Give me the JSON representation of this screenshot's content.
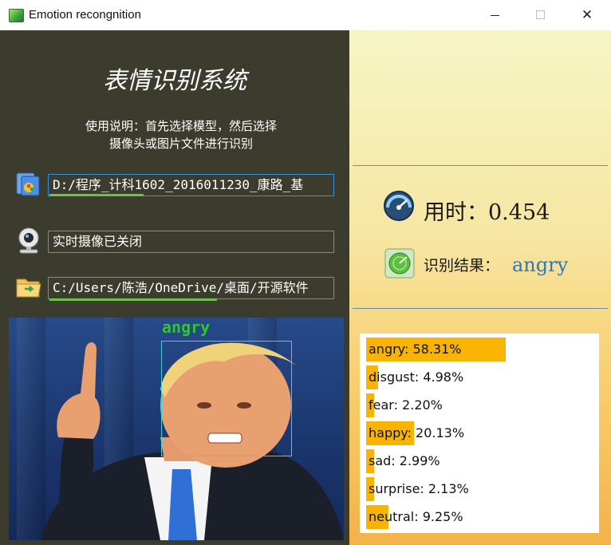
{
  "window": {
    "title": "Emotion recongnition",
    "close_glyph": "✕"
  },
  "left_panel": {
    "system_title": "表情识别系统",
    "instructions_line1": "使用说明：首先选择模型，然后选择",
    "instructions_line2": "摄像头或图片文件进行识别",
    "model_path": "D:/程序_计科1602_2016011230_康路_基",
    "camera_status": "实时摄像已关闭",
    "image_path": "C:/Users/陈浩/OneDrive/桌面/开源软件",
    "icons": {
      "model": "folder-windows-icon",
      "camera": "webcam-icon",
      "image": "open-folder-icon"
    },
    "photo": {
      "detected_label": "angry"
    }
  },
  "right_panel": {
    "time_text": "用时：0.454",
    "result_label": "识别结果：",
    "result_value": "angry",
    "icons": {
      "time": "speedometer-icon",
      "result": "radar-icon"
    },
    "probabilities": [
      {
        "emotion": "angry",
        "percent": 58.31,
        "text": "angry: 58.31%"
      },
      {
        "emotion": "disgust",
        "percent": 4.98,
        "text": "disgust: 4.98%"
      },
      {
        "emotion": "fear",
        "percent": 2.2,
        "text": "fear: 2.20%"
      },
      {
        "emotion": "happy",
        "percent": 20.13,
        "text": "happy: 20.13%"
      },
      {
        "emotion": "sad",
        "percent": 2.99,
        "text": "sad: 2.99%"
      },
      {
        "emotion": "surprise",
        "percent": 2.13,
        "text": "surprise: 2.13%"
      },
      {
        "emotion": "neutral",
        "percent": 9.25,
        "text": "neutral: 9.25%"
      }
    ],
    "bar_color": "#f8b400"
  },
  "colors": {
    "left_bg": "#3c3c2e",
    "accent_green": "#6cc24a",
    "result_blue": "#2e77b8",
    "box_cyan": "#3fd0e0"
  }
}
